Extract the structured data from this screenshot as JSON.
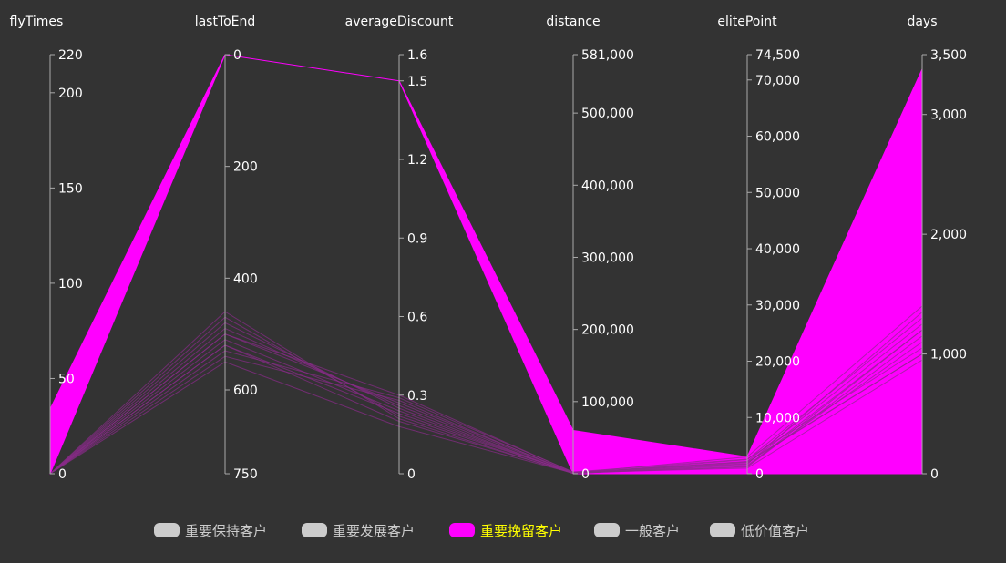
{
  "chart_data": {
    "type": "parallel",
    "axes": [
      {
        "name": "flyTimes",
        "min": 0,
        "max": 220,
        "inverse": false,
        "ticks": [
          0,
          50,
          100,
          150,
          200,
          220
        ],
        "tick_labels": [
          "0",
          "50",
          "100",
          "150",
          "200",
          "220"
        ]
      },
      {
        "name": "lastToEnd",
        "min": 0,
        "max": 750,
        "inverse": true,
        "ticks": [
          0,
          200,
          400,
          600,
          750
        ],
        "tick_labels": [
          "0",
          "200",
          "400",
          "600",
          "750"
        ]
      },
      {
        "name": "averageDiscount",
        "min": 0,
        "max": 1.6,
        "inverse": false,
        "ticks": [
          0,
          0.3,
          0.6,
          0.9,
          1.2,
          1.5,
          1.6
        ],
        "tick_labels": [
          "0",
          "0.3",
          "0.6",
          "0.9",
          "1.2",
          "1.5",
          "1.6"
        ]
      },
      {
        "name": "distance",
        "min": 0,
        "max": 581000,
        "inverse": false,
        "ticks": [
          0,
          100000,
          200000,
          300000,
          400000,
          500000,
          581000
        ],
        "tick_labels": [
          "0",
          "100,000",
          "200,000",
          "300,000",
          "400,000",
          "500,000",
          "581,000"
        ]
      },
      {
        "name": "elitePoint",
        "min": 0,
        "max": 74500,
        "inverse": false,
        "ticks": [
          0,
          10000,
          20000,
          30000,
          40000,
          50000,
          60000,
          70000,
          74500
        ],
        "tick_labels": [
          "0",
          "10,000",
          "20,000",
          "30,000",
          "40,000",
          "50,000",
          "60,000",
          "70,000",
          "74,500"
        ]
      },
      {
        "name": "days",
        "min": 0,
        "max": 3500,
        "inverse": false,
        "ticks": [
          0,
          1000,
          2000,
          3000,
          3500
        ],
        "tick_labels": [
          "0",
          "1,000",
          "2,000",
          "3,000",
          "3,500"
        ]
      }
    ],
    "series": [
      {
        "name": "重要保持客户",
        "active": false
      },
      {
        "name": "重要发展客户",
        "active": false
      },
      {
        "name": "重要挽留客户",
        "active": true
      }
    ],
    "highlighted_band": {
      "series": "重要挽留客户",
      "low": [
        0,
        0,
        1.5,
        0,
        0,
        0
      ],
      "high": [
        34,
        0,
        1.5,
        60000,
        3000,
        3380
      ]
    },
    "dark_lines": [
      [
        0,
        480,
        0.25,
        0,
        2000,
        1000
      ],
      [
        0,
        520,
        0.2,
        1000,
        1500,
        1100
      ],
      [
        0,
        540,
        0.28,
        500,
        2500,
        1300
      ],
      [
        0,
        500,
        0.3,
        2000,
        1800,
        1200
      ],
      [
        0,
        470,
        0.22,
        1500,
        1000,
        950
      ],
      [
        0,
        550,
        0.18,
        800,
        2200,
        1250
      ],
      [
        0,
        490,
        0.26,
        1200,
        3000,
        1400
      ],
      [
        0,
        510,
        0.24,
        600,
        1200,
        1150
      ],
      [
        0,
        530,
        0.29,
        2500,
        2600,
        1050
      ],
      [
        0,
        460,
        0.21,
        300,
        1700,
        1350
      ],
      [
        0,
        500,
        0.27,
        1800,
        2100,
        1000
      ],
      [
        0,
        520,
        0.23,
        900,
        1300,
        1200
      ]
    ],
    "legend": {
      "position": "bottom-center",
      "items": [
        {
          "label": "重要保持客户",
          "color": "#cccccc",
          "text_color": "#cccccc"
        },
        {
          "label": "重要发展客户",
          "color": "#cccccc",
          "text_color": "#cccccc"
        },
        {
          "label": "重要挽留客户",
          "color": "#ff00ff",
          "text_color": "#ffff00"
        },
        {
          "label": "一般客户",
          "color": "#cccccc",
          "text_color": "#cccccc"
        },
        {
          "label": "低价值客户",
          "color": "#cccccc",
          "text_color": "#cccccc"
        }
      ]
    },
    "colors": {
      "background": "#333333",
      "highlight": "#ff00ff",
      "dark_line": "#8a2b8a",
      "axis_line": "#aaaaaa",
      "text": "#ffffff"
    }
  }
}
